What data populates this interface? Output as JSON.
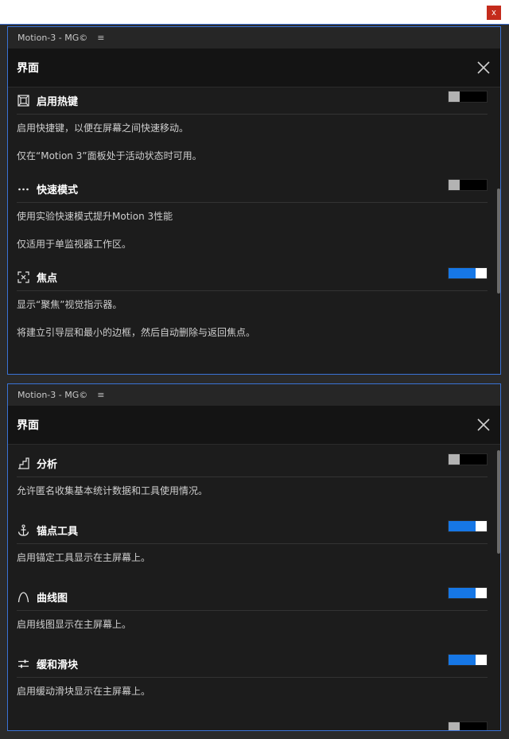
{
  "window": {
    "close_label": "x"
  },
  "panels": [
    {
      "tab_label": "Motion-3 - MG©",
      "menu_glyph": "≡",
      "header_title": "界面",
      "sections": [
        {
          "title": "启用热键",
          "toggle": "off",
          "descs": [
            "启用快捷键，以便在屏幕之间快速移动。",
            "仅在“Motion 3”面板处于活动状态时可用。"
          ]
        },
        {
          "title": "快速模式",
          "toggle": "off",
          "descs": [
            "使用实验快速模式提升Motion 3性能",
            "仅适用于单监视器工作区。"
          ]
        },
        {
          "title": "焦点",
          "toggle": "on",
          "descs": [
            "显示“聚焦”视觉指示器。",
            "将建立引导层和最小的边框，然后自动删除与返回焦点。"
          ]
        }
      ]
    },
    {
      "tab_label": "Motion-3 - MG©",
      "menu_glyph": "≡",
      "header_title": "界面",
      "sections": [
        {
          "title": "分析",
          "toggle": "off",
          "descs": [
            "允许匿名收集基本统计数据和工具使用情况。"
          ]
        },
        {
          "title": "锚点工具",
          "toggle": "on",
          "descs": [
            "启用锚定工具显示在主屏幕上。"
          ]
        },
        {
          "title": "曲线图",
          "toggle": "on",
          "descs": [
            "启用线图显示在主屏幕上。"
          ]
        },
        {
          "title": "缓和滑块",
          "toggle": "on",
          "descs": [
            "启用缓动滑块显示在主屏幕上。"
          ]
        }
      ]
    }
  ],
  "colors": {
    "accent": "#1677e6",
    "panel_border": "#3a73d6"
  }
}
